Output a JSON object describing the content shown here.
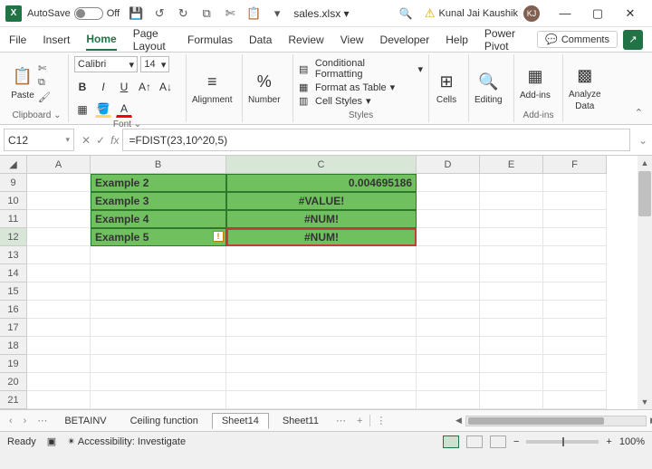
{
  "titlebar": {
    "app_initial": "X",
    "autosave_label": "AutoSave",
    "autosave_state": "Off",
    "filename": "sales.xlsx  ▾",
    "user_name": "Kunal Jai Kaushik",
    "user_initials": "KJ"
  },
  "ribbon_tabs": {
    "file": "File",
    "insert": "Insert",
    "home": "Home",
    "page_layout": "Page Layout",
    "formulas": "Formulas",
    "data": "Data",
    "review": "Review",
    "view": "View",
    "developer": "Developer",
    "help": "Help",
    "power_pivot": "Power Pivot",
    "comments": "Comments"
  },
  "ribbon": {
    "clipboard": {
      "paste": "Paste",
      "label": "Clipboard"
    },
    "font": {
      "name": "Calibri",
      "size": "14",
      "label": "Font"
    },
    "alignment": {
      "label": "Alignment"
    },
    "number": {
      "label": "Number"
    },
    "styles": {
      "cond_format": "Conditional Formatting",
      "format_table": "Format as Table",
      "cell_styles": "Cell Styles",
      "label": "Styles"
    },
    "cells": {
      "label": "Cells"
    },
    "editing": {
      "label": "Editing"
    },
    "addins": {
      "btn": "Add-ins",
      "label": "Add-ins"
    },
    "analyze": {
      "btn1": "Analyze",
      "btn2": "Data"
    }
  },
  "formula_bar": {
    "cell_ref": "C12",
    "formula": "=FDIST(23,10^20,5)"
  },
  "columns": [
    "A",
    "B",
    "C",
    "D",
    "E",
    "F"
  ],
  "rows": [
    "9",
    "10",
    "11",
    "12",
    "13",
    "14",
    "15",
    "16",
    "17",
    "18",
    "19",
    "20",
    "21"
  ],
  "cells": {
    "b9": "Example 2",
    "c9": "0.004695186",
    "b10": "Example 3",
    "c10": "#VALUE!",
    "b11": "Example 4",
    "c11": "#NUM!",
    "b12": "Example 5",
    "c12": "#NUM!"
  },
  "sheet_tabs": {
    "t1": "BETAINV",
    "t2": "Ceiling function",
    "t3": "Sheet14",
    "t4": "Sheet11"
  },
  "status": {
    "ready": "Ready",
    "access": "Accessibility: Investigate",
    "zoom": "100%"
  }
}
